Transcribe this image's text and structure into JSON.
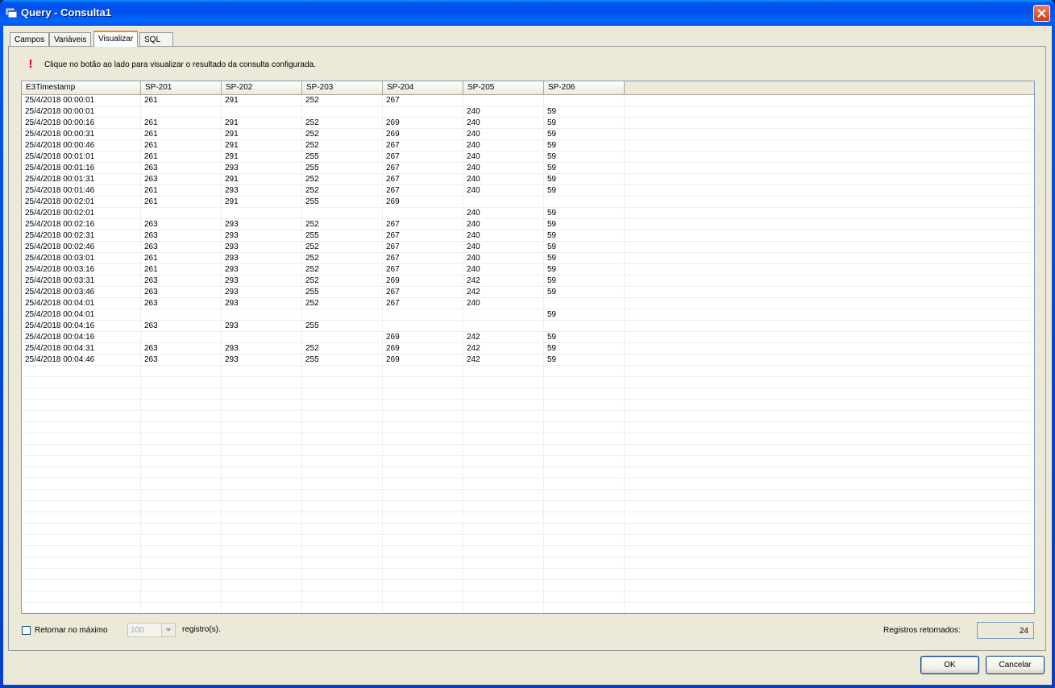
{
  "window": {
    "title": "Query - Consulta1",
    "icon": "window-app-icon",
    "close_icon": "close-icon"
  },
  "tabs": [
    {
      "label": "Campos",
      "active": false
    },
    {
      "label": "Variáveis",
      "active": false
    },
    {
      "label": "Visualizar",
      "active": true
    },
    {
      "label": "SQL",
      "active": false
    }
  ],
  "info": {
    "icon": "exclamation-icon",
    "text": "Clique no botão ao lado para visualizar o resultado da consulta configurada."
  },
  "grid": {
    "columns": [
      "E3Timestamp",
      "SP-201",
      "SP-202",
      "SP-203",
      "SP-204",
      "SP-205",
      "SP-206"
    ],
    "rows": [
      [
        "25/4/2018 00:00:01",
        "261",
        "291",
        "252",
        "267",
        "",
        ""
      ],
      [
        "25/4/2018 00:00:01",
        "",
        "",
        "",
        "",
        "240",
        "59"
      ],
      [
        "25/4/2018 00:00:16",
        "261",
        "291",
        "252",
        "269",
        "240",
        "59"
      ],
      [
        "25/4/2018 00:00:31",
        "261",
        "291",
        "252",
        "269",
        "240",
        "59"
      ],
      [
        "25/4/2018 00:00:46",
        "261",
        "291",
        "252",
        "267",
        "240",
        "59"
      ],
      [
        "25/4/2018 00:01:01",
        "261",
        "291",
        "255",
        "267",
        "240",
        "59"
      ],
      [
        "25/4/2018 00:01:16",
        "263",
        "293",
        "255",
        "267",
        "240",
        "59"
      ],
      [
        "25/4/2018 00:01:31",
        "263",
        "291",
        "252",
        "267",
        "240",
        "59"
      ],
      [
        "25/4/2018 00:01:46",
        "261",
        "293",
        "252",
        "267",
        "240",
        "59"
      ],
      [
        "25/4/2018 00:02:01",
        "261",
        "291",
        "255",
        "269",
        "",
        ""
      ],
      [
        "25/4/2018 00:02:01",
        "",
        "",
        "",
        "",
        "240",
        "59"
      ],
      [
        "25/4/2018 00:02:16",
        "263",
        "293",
        "252",
        "267",
        "240",
        "59"
      ],
      [
        "25/4/2018 00:02:31",
        "263",
        "293",
        "255",
        "267",
        "240",
        "59"
      ],
      [
        "25/4/2018 00:02:46",
        "263",
        "293",
        "252",
        "267",
        "240",
        "59"
      ],
      [
        "25/4/2018 00:03:01",
        "261",
        "293",
        "252",
        "267",
        "240",
        "59"
      ],
      [
        "25/4/2018 00:03:16",
        "261",
        "293",
        "252",
        "267",
        "240",
        "59"
      ],
      [
        "25/4/2018 00:03:31",
        "263",
        "293",
        "252",
        "269",
        "242",
        "59"
      ],
      [
        "25/4/2018 00:03:46",
        "263",
        "293",
        "255",
        "267",
        "242",
        "59"
      ],
      [
        "25/4/2018 00:04:01",
        "263",
        "293",
        "252",
        "267",
        "240",
        ""
      ],
      [
        "25/4/2018 00:04:01",
        "",
        "",
        "",
        "",
        "",
        "59"
      ],
      [
        "25/4/2018 00:04:16",
        "263",
        "293",
        "255",
        "",
        "",
        ""
      ],
      [
        "25/4/2018 00:04:16",
        "",
        "",
        "",
        "269",
        "242",
        "59"
      ],
      [
        "25/4/2018 00:04:31",
        "263",
        "293",
        "252",
        "269",
        "242",
        "59"
      ],
      [
        "25/4/2018 00:04:46",
        "263",
        "293",
        "255",
        "269",
        "242",
        "59"
      ]
    ]
  },
  "bottom": {
    "max_checkbox_label": "Retornar no máximo",
    "max_checked": false,
    "max_value": "100",
    "registros_label": "registro(s).",
    "returned_label": "Registros retornados:",
    "returned_value": "24"
  },
  "buttons": {
    "ok": "OK",
    "cancel": "Cancelar"
  }
}
